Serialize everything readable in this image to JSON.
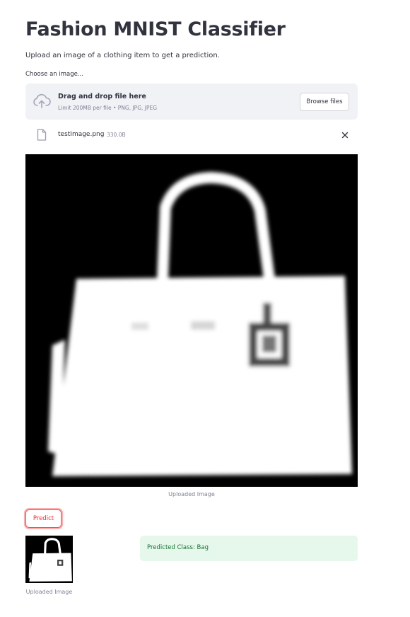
{
  "page": {
    "title": "Fashion MNIST Classifier",
    "subtitle": "Upload an image of a clothing item to get a prediction."
  },
  "uploader": {
    "label": "Choose an image...",
    "dropzone_text": "Drag and drop file here",
    "limit_text": "Limit 200MB per file • PNG, JPG, JPEG",
    "browse_label": "Browse files",
    "upload_icon": "cloud-upload-icon",
    "file": {
      "icon": "file-icon",
      "name": "testImage.png",
      "size": "330.0B",
      "remove_icon": "close-icon"
    }
  },
  "preview": {
    "caption": "Uploaded Image"
  },
  "predict": {
    "button_label": "Predict",
    "accent_color": "#ff4b4b"
  },
  "result": {
    "thumb_caption": "Uploaded Image",
    "message": "Predicted Class: Bag",
    "success_bg": "#e6f8ec",
    "success_text": "#177233"
  }
}
